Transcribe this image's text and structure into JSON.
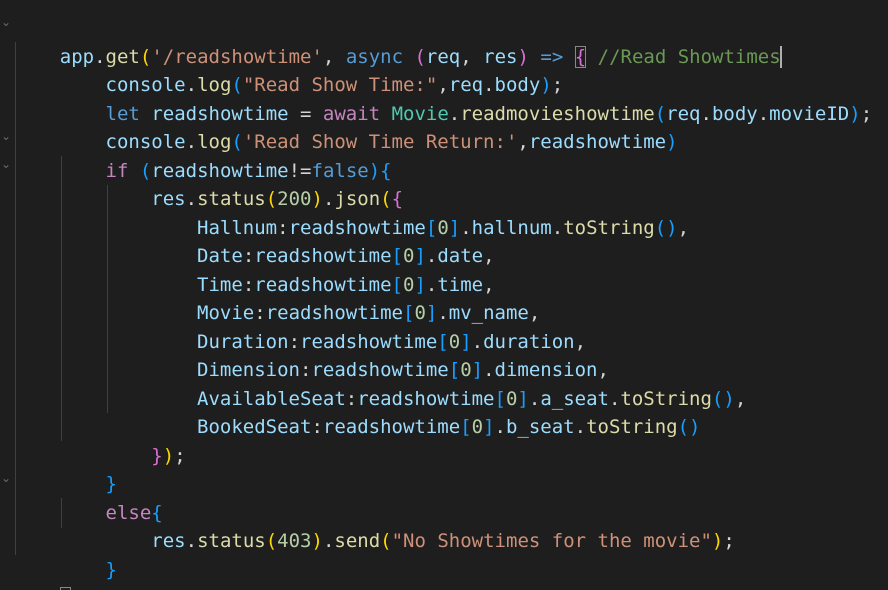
{
  "editor": {
    "theme_background": "#1e1e1e",
    "lines": [
      "app.get('/readshowtime', async (req, res) => { //Read Showtimes",
      "    console.log(\"Read Show Time:\",req.body);",
      "    let readshowtime = await Movie.readmovieshowtime(req.body.movieID);",
      "    console.log('Read Show Time Return:',readshowtime)",
      "    if (readshowtime!=false){",
      "        res.status(200).json({",
      "            Hallnum:readshowtime[0].hallnum.toString(),",
      "            Date:readshowtime[0].date,",
      "            Time:readshowtime[0].time,",
      "            Movie:readshowtime[0].mv_name,",
      "            Duration:readshowtime[0].duration,",
      "            Dimension:readshowtime[0].dimension,",
      "            AvailableSeat:readshowtime[0].a_seat.toString(),",
      "            BookedSeat:readshowtime[0].b_seat.toString()",
      "        });",
      "    }",
      "    else{",
      "        res.status(403).send(\"No Showtimes for the movie\");",
      "    }",
      "})"
    ],
    "tokens": {
      "l0": [
        "app",
        ".",
        "get",
        "(",
        "'/readshowtime'",
        ", ",
        "async",
        " ",
        "(",
        "req",
        ", ",
        "res",
        ")",
        " ",
        "=>",
        " ",
        "{",
        " ",
        "//Read Showtimes"
      ],
      "l1": [
        "    ",
        "console",
        ".",
        "log",
        "(",
        "\"Read Show Time:\"",
        ",",
        "req",
        ".",
        "body",
        ")",
        ";"
      ],
      "l2": [
        "    ",
        "let",
        " ",
        "readshowtime",
        " = ",
        "await",
        " ",
        "Movie",
        ".",
        "readmovieshowtime",
        "(",
        "req",
        ".",
        "body",
        ".",
        "movieID",
        ")",
        ";"
      ],
      "l3": [
        "    ",
        "console",
        ".",
        "log",
        "(",
        "'Read Show Time Return:'",
        ",",
        "readshowtime",
        ")"
      ],
      "l4": [
        "    ",
        "if",
        " ",
        "(",
        "readshowtime",
        "!=",
        "false",
        ")",
        "{"
      ],
      "l5": [
        "        ",
        "res",
        ".",
        "status",
        "(",
        "200",
        ")",
        ".",
        "json",
        "(",
        "{"
      ],
      "l6": [
        "            ",
        "Hallnum",
        ":",
        "readshowtime",
        "[",
        "0",
        "]",
        ".",
        "hallnum",
        ".",
        "toString",
        "()",
        ","
      ],
      "l7": [
        "            ",
        "Date",
        ":",
        "readshowtime",
        "[",
        "0",
        "]",
        ".",
        "date",
        ","
      ],
      "l8": [
        "            ",
        "Time",
        ":",
        "readshowtime",
        "[",
        "0",
        "]",
        ".",
        "time",
        ","
      ],
      "l9": [
        "            ",
        "Movie",
        ":",
        "readshowtime",
        "[",
        "0",
        "]",
        ".",
        "mv_name",
        ","
      ],
      "l10": [
        "            ",
        "Duration",
        ":",
        "readshowtime",
        "[",
        "0",
        "]",
        ".",
        "duration",
        ","
      ],
      "l11": [
        "            ",
        "Dimension",
        ":",
        "readshowtime",
        "[",
        "0",
        "]",
        ".",
        "dimension",
        ","
      ],
      "l12": [
        "            ",
        "AvailableSeat",
        ":",
        "readshowtime",
        "[",
        "0",
        "]",
        ".",
        "a_seat",
        ".",
        "toString",
        "()",
        ","
      ],
      "l13": [
        "            ",
        "BookedSeat",
        ":",
        "readshowtime",
        "[",
        "0",
        "]",
        ".",
        "b_seat",
        ".",
        "toString",
        "()"
      ],
      "l14": [
        "        ",
        "}",
        ")",
        ";"
      ],
      "l15": [
        "    ",
        "}"
      ],
      "l16": [
        "    ",
        "else",
        "{"
      ],
      "l17": [
        "        ",
        "res",
        ".",
        "status",
        "(",
        "403",
        ")",
        ".",
        "send",
        "(",
        "\"No Showtimes for the movie\"",
        ")",
        ";"
      ],
      "l18": [
        "    ",
        "}"
      ],
      "l19": [
        "}",
        ")"
      ]
    },
    "fold_marker": "⌄",
    "colors": {
      "variable": "#9cdcfe",
      "function": "#dcdcaa",
      "class": "#4ec9b0",
      "string": "#ce9178",
      "keyword": "#569cd6",
      "control": "#c586c0",
      "number": "#b5cea8",
      "comment": "#6a9955",
      "bracket_level1": "#ffd700",
      "bracket_level2": "#da70d6",
      "bracket_level3": "#179fff"
    }
  }
}
